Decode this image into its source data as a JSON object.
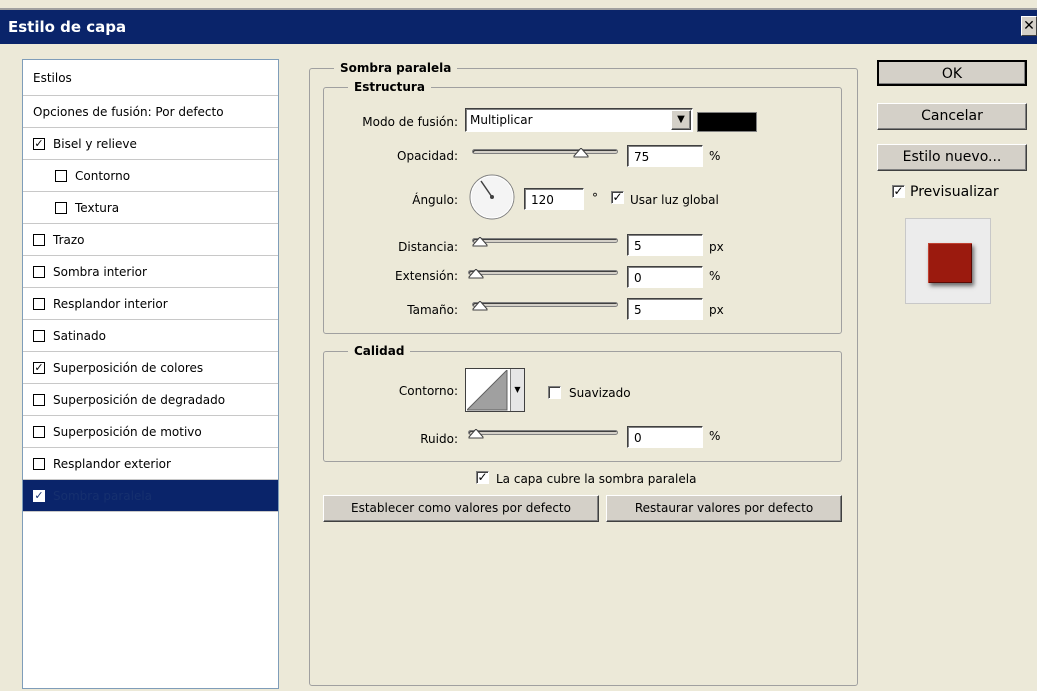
{
  "window": {
    "title": "Estilo de capa",
    "close_glyph": "✕"
  },
  "styles": {
    "header": "Estilos",
    "blend_options": "Opciones de fusión: Por defecto",
    "items": [
      {
        "label": "Bisel y relieve",
        "checked": true
      },
      {
        "label": "Contorno",
        "checked": false
      },
      {
        "label": "Textura",
        "checked": false
      },
      {
        "label": "Trazo",
        "checked": false
      },
      {
        "label": "Sombra interior",
        "checked": false
      },
      {
        "label": "Resplandor interior",
        "checked": false
      },
      {
        "label": "Satinado",
        "checked": false
      },
      {
        "label": "Superposición de colores",
        "checked": true
      },
      {
        "label": "Superposición de degradado",
        "checked": false
      },
      {
        "label": "Superposición de motivo",
        "checked": false
      },
      {
        "label": "Resplandor exterior",
        "checked": false
      },
      {
        "label": "Sombra paralela",
        "checked": true
      }
    ],
    "check_glyph": "✓"
  },
  "panel": {
    "title": "Sombra paralela",
    "structure": {
      "title": "Estructura",
      "blend_mode_label": "Modo de fusión:",
      "blend_mode_value": "Multiplicar",
      "shadow_color": "#000000",
      "opacity_label": "Opacidad:",
      "opacity_value": "75",
      "opacity_unit": "%",
      "angle_label": "Ángulo:",
      "angle_value": "120",
      "angle_unit": "°",
      "global_light_label": "Usar luz global",
      "global_light_checked": true,
      "distance_label": "Distancia:",
      "distance_value": "5",
      "distance_unit": "px",
      "spread_label": "Extensión:",
      "spread_value": "0",
      "spread_unit": "%",
      "size_label": "Tamaño:",
      "size_value": "5",
      "size_unit": "px"
    },
    "quality": {
      "title": "Calidad",
      "contour_label": "Contorno:",
      "antialias_label": "Suavizado",
      "antialias_checked": false,
      "noise_label": "Ruido:",
      "noise_value": "0",
      "noise_unit": "%"
    },
    "knockout_label": "La capa cubre la sombra paralela",
    "knockout_checked": true,
    "set_default_button": "Establecer como valores por defecto",
    "reset_default_button": "Restaurar valores por defecto"
  },
  "actions": {
    "ok": "OK",
    "cancel": "Cancelar",
    "new_style": "Estilo nuevo...",
    "preview_label": "Previsualizar",
    "preview_checked": true,
    "preview_color": "#9b1a0e"
  }
}
